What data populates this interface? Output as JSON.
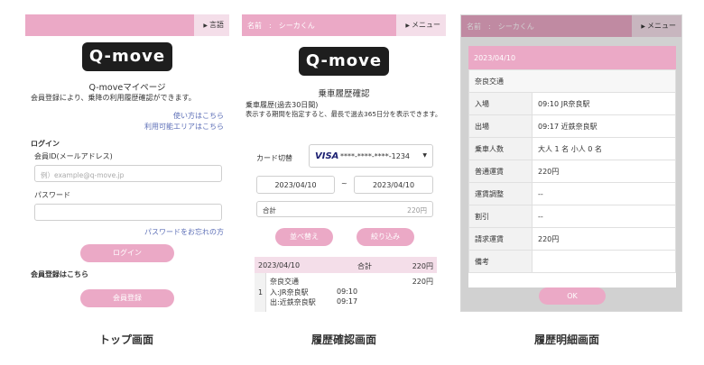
{
  "top": {
    "lang_label": "言語",
    "logo": "Q-move",
    "title": "Q-moveマイページ",
    "desc": "会員登録により、乗降の利用履歴確認ができます。",
    "link_usage": "使い方はこちら",
    "link_area": "利用可能エリアはこちら",
    "login_heading": "ログイン",
    "id_label": "会員ID(メールアドレス)",
    "id_placeholder": "例）example@q-move.jp",
    "password_label": "パスワード",
    "forgot_link": "パスワードをお忘れの方",
    "login_button": "ログイン",
    "register_heading": "会員登録はこちら",
    "register_button": "会員登録",
    "caption": "トップ画面"
  },
  "history": {
    "name_label": "名前",
    "name_value": "シーカくん",
    "menu_label": "メニュー",
    "logo": "Q-move",
    "title": "乗車履歴確認",
    "desc1": "乗車履歴(過去30日間)",
    "desc2": "表示する期間を指定すると、最長で過去365日分を表示できます。",
    "card_label": "カード切替",
    "card_brand": "VISA",
    "card_number": "****-****-****-1234",
    "date_from": "2023/04/10",
    "date_sep": "~",
    "date_to": "2023/04/10",
    "total_label": "合計",
    "total_value": "220円",
    "sort_button": "並べ替え",
    "filter_button": "絞り込み",
    "list_date": "2023/04/10",
    "list_total_label": "合計",
    "list_total_value": "220円",
    "item_no": "1",
    "item_operator": "奈良交通",
    "item_fare": "220円",
    "item_in": "入:JR奈良駅",
    "item_in_time": "09:10",
    "item_out": "出:近鉄奈良駅",
    "item_out_time": "09:17",
    "caption": "履歴確認画面"
  },
  "detail": {
    "name_label": "名前",
    "name_value": "シーカくん",
    "menu_label": "メニュー",
    "date": "2023/04/10",
    "operator": "奈良交通",
    "rows": [
      {
        "k": "入場",
        "v": "09:10  JR奈良駅"
      },
      {
        "k": "出場",
        "v": "09:17  近鉄奈良駅"
      },
      {
        "k": "乗車人数",
        "v": "大人 1 名  小人 0 名"
      },
      {
        "k": "普通運賃",
        "v": "220円"
      },
      {
        "k": "運賃調整",
        "v": "--"
      },
      {
        "k": "割引",
        "v": "--"
      },
      {
        "k": "請求運賃",
        "v": "220円"
      },
      {
        "k": "備考",
        "v": ""
      }
    ],
    "ok_button": "OK",
    "caption": "履歴明細画面"
  },
  "colors": {
    "accent": "#eba9c6",
    "accent_light": "#f4dee9",
    "link": "#5d6fb7"
  }
}
